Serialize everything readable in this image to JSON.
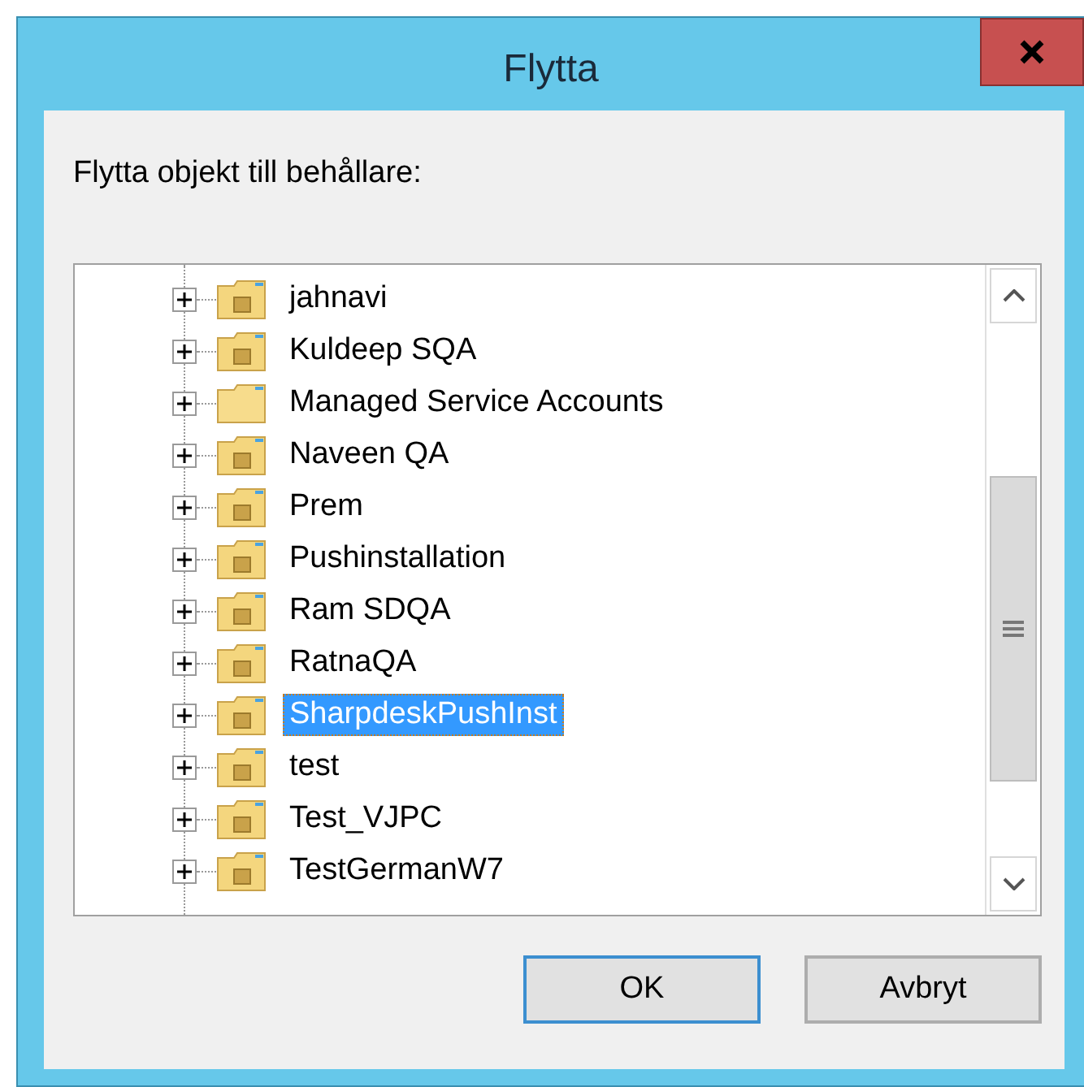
{
  "window": {
    "title": "Flytta"
  },
  "label": "Flytta objekt till behållare:",
  "tree": {
    "items": [
      {
        "name": "jahnavi",
        "kind": "ou",
        "expanded": false,
        "selected": false
      },
      {
        "name": "Kuldeep SQA",
        "kind": "ou",
        "expanded": false,
        "selected": false
      },
      {
        "name": "Managed Service Accounts",
        "kind": "folder",
        "expanded": false,
        "selected": false
      },
      {
        "name": "Naveen QA",
        "kind": "ou",
        "expanded": false,
        "selected": false
      },
      {
        "name": "Prem",
        "kind": "ou",
        "expanded": false,
        "selected": false
      },
      {
        "name": "Pushinstallation",
        "kind": "ou",
        "expanded": false,
        "selected": false
      },
      {
        "name": "Ram SDQA",
        "kind": "ou",
        "expanded": false,
        "selected": false
      },
      {
        "name": "RatnaQA",
        "kind": "ou",
        "expanded": false,
        "selected": false
      },
      {
        "name": "SharpdeskPushInst",
        "kind": "ou",
        "expanded": false,
        "selected": true
      },
      {
        "name": "test",
        "kind": "ou",
        "expanded": false,
        "selected": false
      },
      {
        "name": "Test_VJPC",
        "kind": "ou",
        "expanded": false,
        "selected": false
      },
      {
        "name": "TestGermanW7",
        "kind": "ou",
        "expanded": false,
        "selected": false
      }
    ]
  },
  "buttons": [
    {
      "label": "OK",
      "default": true
    },
    {
      "label": "Avbryt",
      "default": false
    }
  ]
}
